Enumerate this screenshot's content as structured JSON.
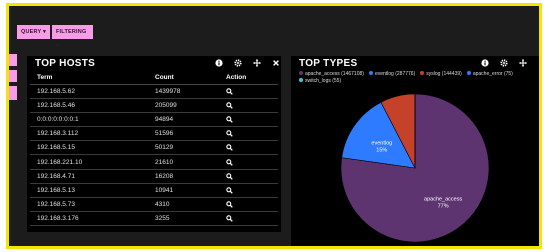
{
  "toolbar": {
    "query_label": "QUERY ▾",
    "filtering_label": "FILTERING ▾"
  },
  "hosts_panel": {
    "title": "TOP HOSTS",
    "columns": [
      "Term",
      "Count",
      "Action"
    ],
    "rows": [
      {
        "term": "192.168.5.62",
        "count": "1439978"
      },
      {
        "term": "192.168.5.46",
        "count": "205099"
      },
      {
        "term": "0:0:0:0:0:0:0:1",
        "count": "94894"
      },
      {
        "term": "192.168.3.112",
        "count": "51596"
      },
      {
        "term": "192.168.5.15",
        "count": "50129"
      },
      {
        "term": "192.168.221.10",
        "count": "21610"
      },
      {
        "term": "192.168.4.71",
        "count": "16208"
      },
      {
        "term": "192.168.5.13",
        "count": "10941"
      },
      {
        "term": "192.168.5.73",
        "count": "4310"
      },
      {
        "term": "192.168.3.176",
        "count": "3255"
      }
    ]
  },
  "types_panel": {
    "title": "TOP TYPES",
    "legend": [
      {
        "label": "apache_access (1467108)",
        "color": "#5d3470"
      },
      {
        "label": "eventlog (287776)",
        "color": "#2f7bff"
      },
      {
        "label": "syslog (144439)",
        "color": "#c4412a"
      },
      {
        "label": "apache_error (75)",
        "color": "#2f7bff"
      },
      {
        "label": "switch_logs (55)",
        "color": "#3ec7d6"
      }
    ]
  },
  "chart_data": {
    "type": "pie",
    "slices": [
      {
        "name": "apache_access",
        "value": 1467108,
        "label": "apache_access",
        "percent_label": "77%",
        "color": "#5d3470"
      },
      {
        "name": "eventlog",
        "value": 287776,
        "label": "eventlog",
        "percent_label": "15%",
        "color": "#2f7bff"
      },
      {
        "name": "syslog",
        "value": 144439,
        "label": "",
        "percent_label": "",
        "color": "#c4412a"
      },
      {
        "name": "apache_error",
        "value": 75,
        "label": "",
        "percent_label": "",
        "color": "#2f7bff"
      },
      {
        "name": "switch_logs",
        "value": 55,
        "label": "",
        "percent_label": "",
        "color": "#3ec7d6"
      }
    ],
    "legend_placement": "top"
  }
}
